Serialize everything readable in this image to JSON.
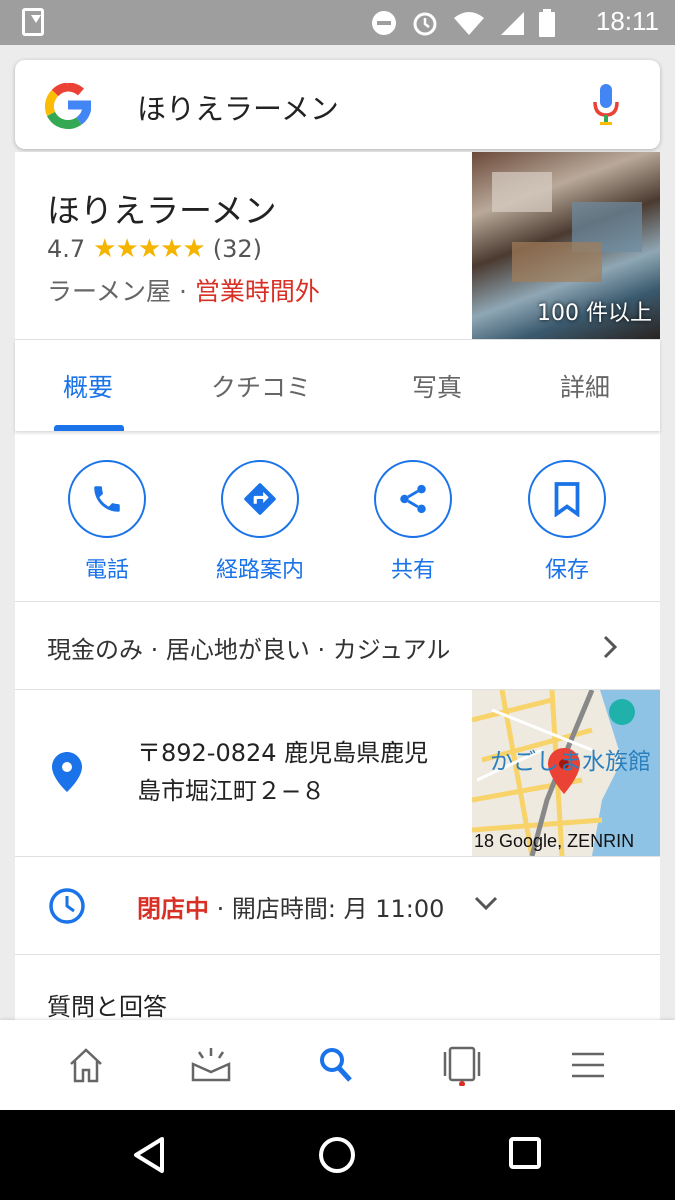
{
  "status_bar": {
    "time": "18:11"
  },
  "search": {
    "query": "ほりえラーメン",
    "logo_letter": "G"
  },
  "place": {
    "name": "ほりえラーメン",
    "rating": "4.7",
    "stars": "★★★★★",
    "review_count": "(32)",
    "category": "ラーメン屋",
    "separator": " · ",
    "open_status": "営業時間外",
    "photo_count": "100 件以上"
  },
  "tabs": [
    {
      "label": "概要",
      "active": true
    },
    {
      "label": "クチコミ",
      "active": false
    },
    {
      "label": "写真",
      "active": false
    },
    {
      "label": "詳細",
      "active": false
    }
  ],
  "actions": [
    {
      "label": "電話",
      "icon": "phone-icon"
    },
    {
      "label": "経路案内",
      "icon": "directions-icon"
    },
    {
      "label": "共有",
      "icon": "share-icon"
    },
    {
      "label": "保存",
      "icon": "bookmark-icon"
    }
  ],
  "attributes": "現金のみ · 居心地が良い · カジュアル",
  "address": {
    "text": "〒892-0824 鹿児島県鹿児島市堀江町２−８",
    "map_label": "かごしま水族館",
    "map_credit": "18 Google, ZENRIN"
  },
  "hours": {
    "status": "閉店中",
    "detail": " · 開店時間: 月 11:00"
  },
  "qa_title": "質問と回答",
  "colors": {
    "accent": "#1a73e8",
    "closed": "#d93025",
    "star": "#f5b400"
  }
}
